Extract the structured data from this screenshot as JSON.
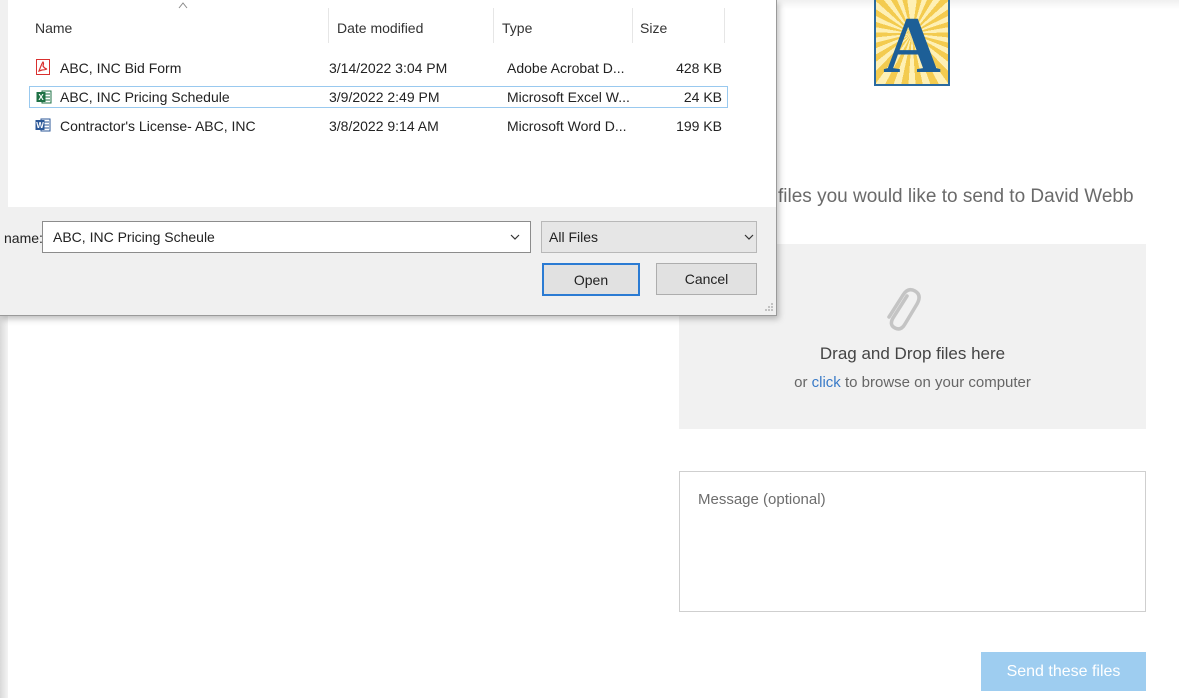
{
  "page": {
    "instructions": "files you would like to send to David Webb",
    "logo_letter": "A",
    "dropzone": {
      "title": "Drag and Drop files here",
      "sub_prefix": "or ",
      "sub_link": "click",
      "sub_suffix": " to browse on your computer"
    },
    "message_placeholder": "Message (optional)",
    "send_label": "Send these files"
  },
  "dialog": {
    "columns": [
      "Name",
      "Date modified",
      "Type",
      "Size"
    ],
    "files": [
      {
        "name": "ABC, INC Bid Form",
        "date": "3/14/2022 3:04 PM",
        "type": "Adobe Acrobat D...",
        "size": "428 KB",
        "icon": "pdf-file-icon"
      },
      {
        "name": "ABC, INC Pricing Schedule",
        "date": "3/9/2022 2:49 PM",
        "type": "Microsoft Excel W...",
        "size": "24 KB",
        "icon": "excel-file-icon",
        "selected": true
      },
      {
        "name": "Contractor's License- ABC, INC",
        "date": "3/8/2022 9:14 AM",
        "type": "Microsoft Word D...",
        "size": "199 KB",
        "icon": "word-file-icon"
      }
    ],
    "filename_label": "name:",
    "filename_value": "ABC, INC Pricing Scheule",
    "filter_value": "All Files",
    "open_label": "Open",
    "cancel_label": "Cancel"
  },
  "colors": {
    "accent": "#2b7bd3",
    "send_button": "#9ecdf0",
    "link": "#3a7bc8",
    "pdf": "#d9302f",
    "excel": "#1e7145",
    "word": "#2b5797"
  }
}
